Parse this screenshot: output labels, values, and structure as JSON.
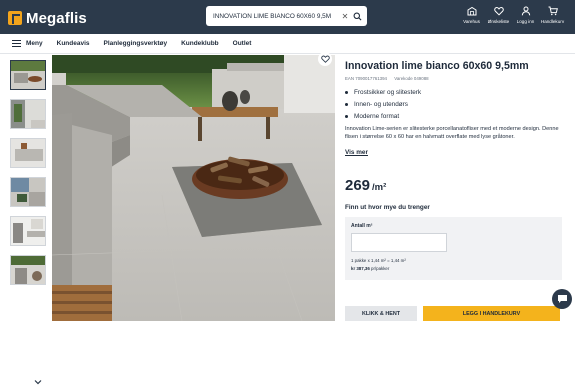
{
  "header": {
    "logo_text": "Megaflis",
    "search": {
      "value": "INNOVATION LIME BIANCO 60X60 9,5M",
      "clear_glyph": "✕"
    },
    "icons": [
      {
        "name": "warehouse-icon",
        "label": "Varehus"
      },
      {
        "name": "heart-icon",
        "label": "Ønskeliste"
      },
      {
        "name": "user-icon",
        "label": "Logg inn"
      },
      {
        "name": "cart-icon",
        "label": "Handlekurv"
      }
    ]
  },
  "nav": {
    "menu_label": "Meny",
    "links": [
      "Kundeavis",
      "Planleggingsverktøy",
      "Kundeklubb",
      "Outlet"
    ]
  },
  "product": {
    "title": "Innovation lime bianco 60x60 9,5mm",
    "ean": "EAN 7090017761394",
    "item_no": "Varekode 049088",
    "features": [
      "Frostsikker og slitesterk",
      "Innen- og utendørs",
      "Moderne format"
    ],
    "description": "Innovation Lime-serien er slitesterke porcellanatofliser med et moderne design. Denne flisen i størrelse 60 x 60 har en halvmatt overflate med lyse gråtoner.",
    "more_link": "Vis mer",
    "price": "269",
    "price_unit": "/m²",
    "calc": {
      "title": "Finn ut hvor mye du trenger",
      "field_label": "Antall m²",
      "equation": "1 pakke x 1,44 m² = 1,44 m²",
      "sum_value": "kr 387,36",
      "sum_suffix": " pr/pakker"
    },
    "buttons": {
      "pickup": "KLIKK & HENT",
      "cart": "LEGG I HANDLEKURV"
    }
  },
  "colors": {
    "header_bg": "#2c3a4b",
    "accent": "#f4b31c"
  }
}
